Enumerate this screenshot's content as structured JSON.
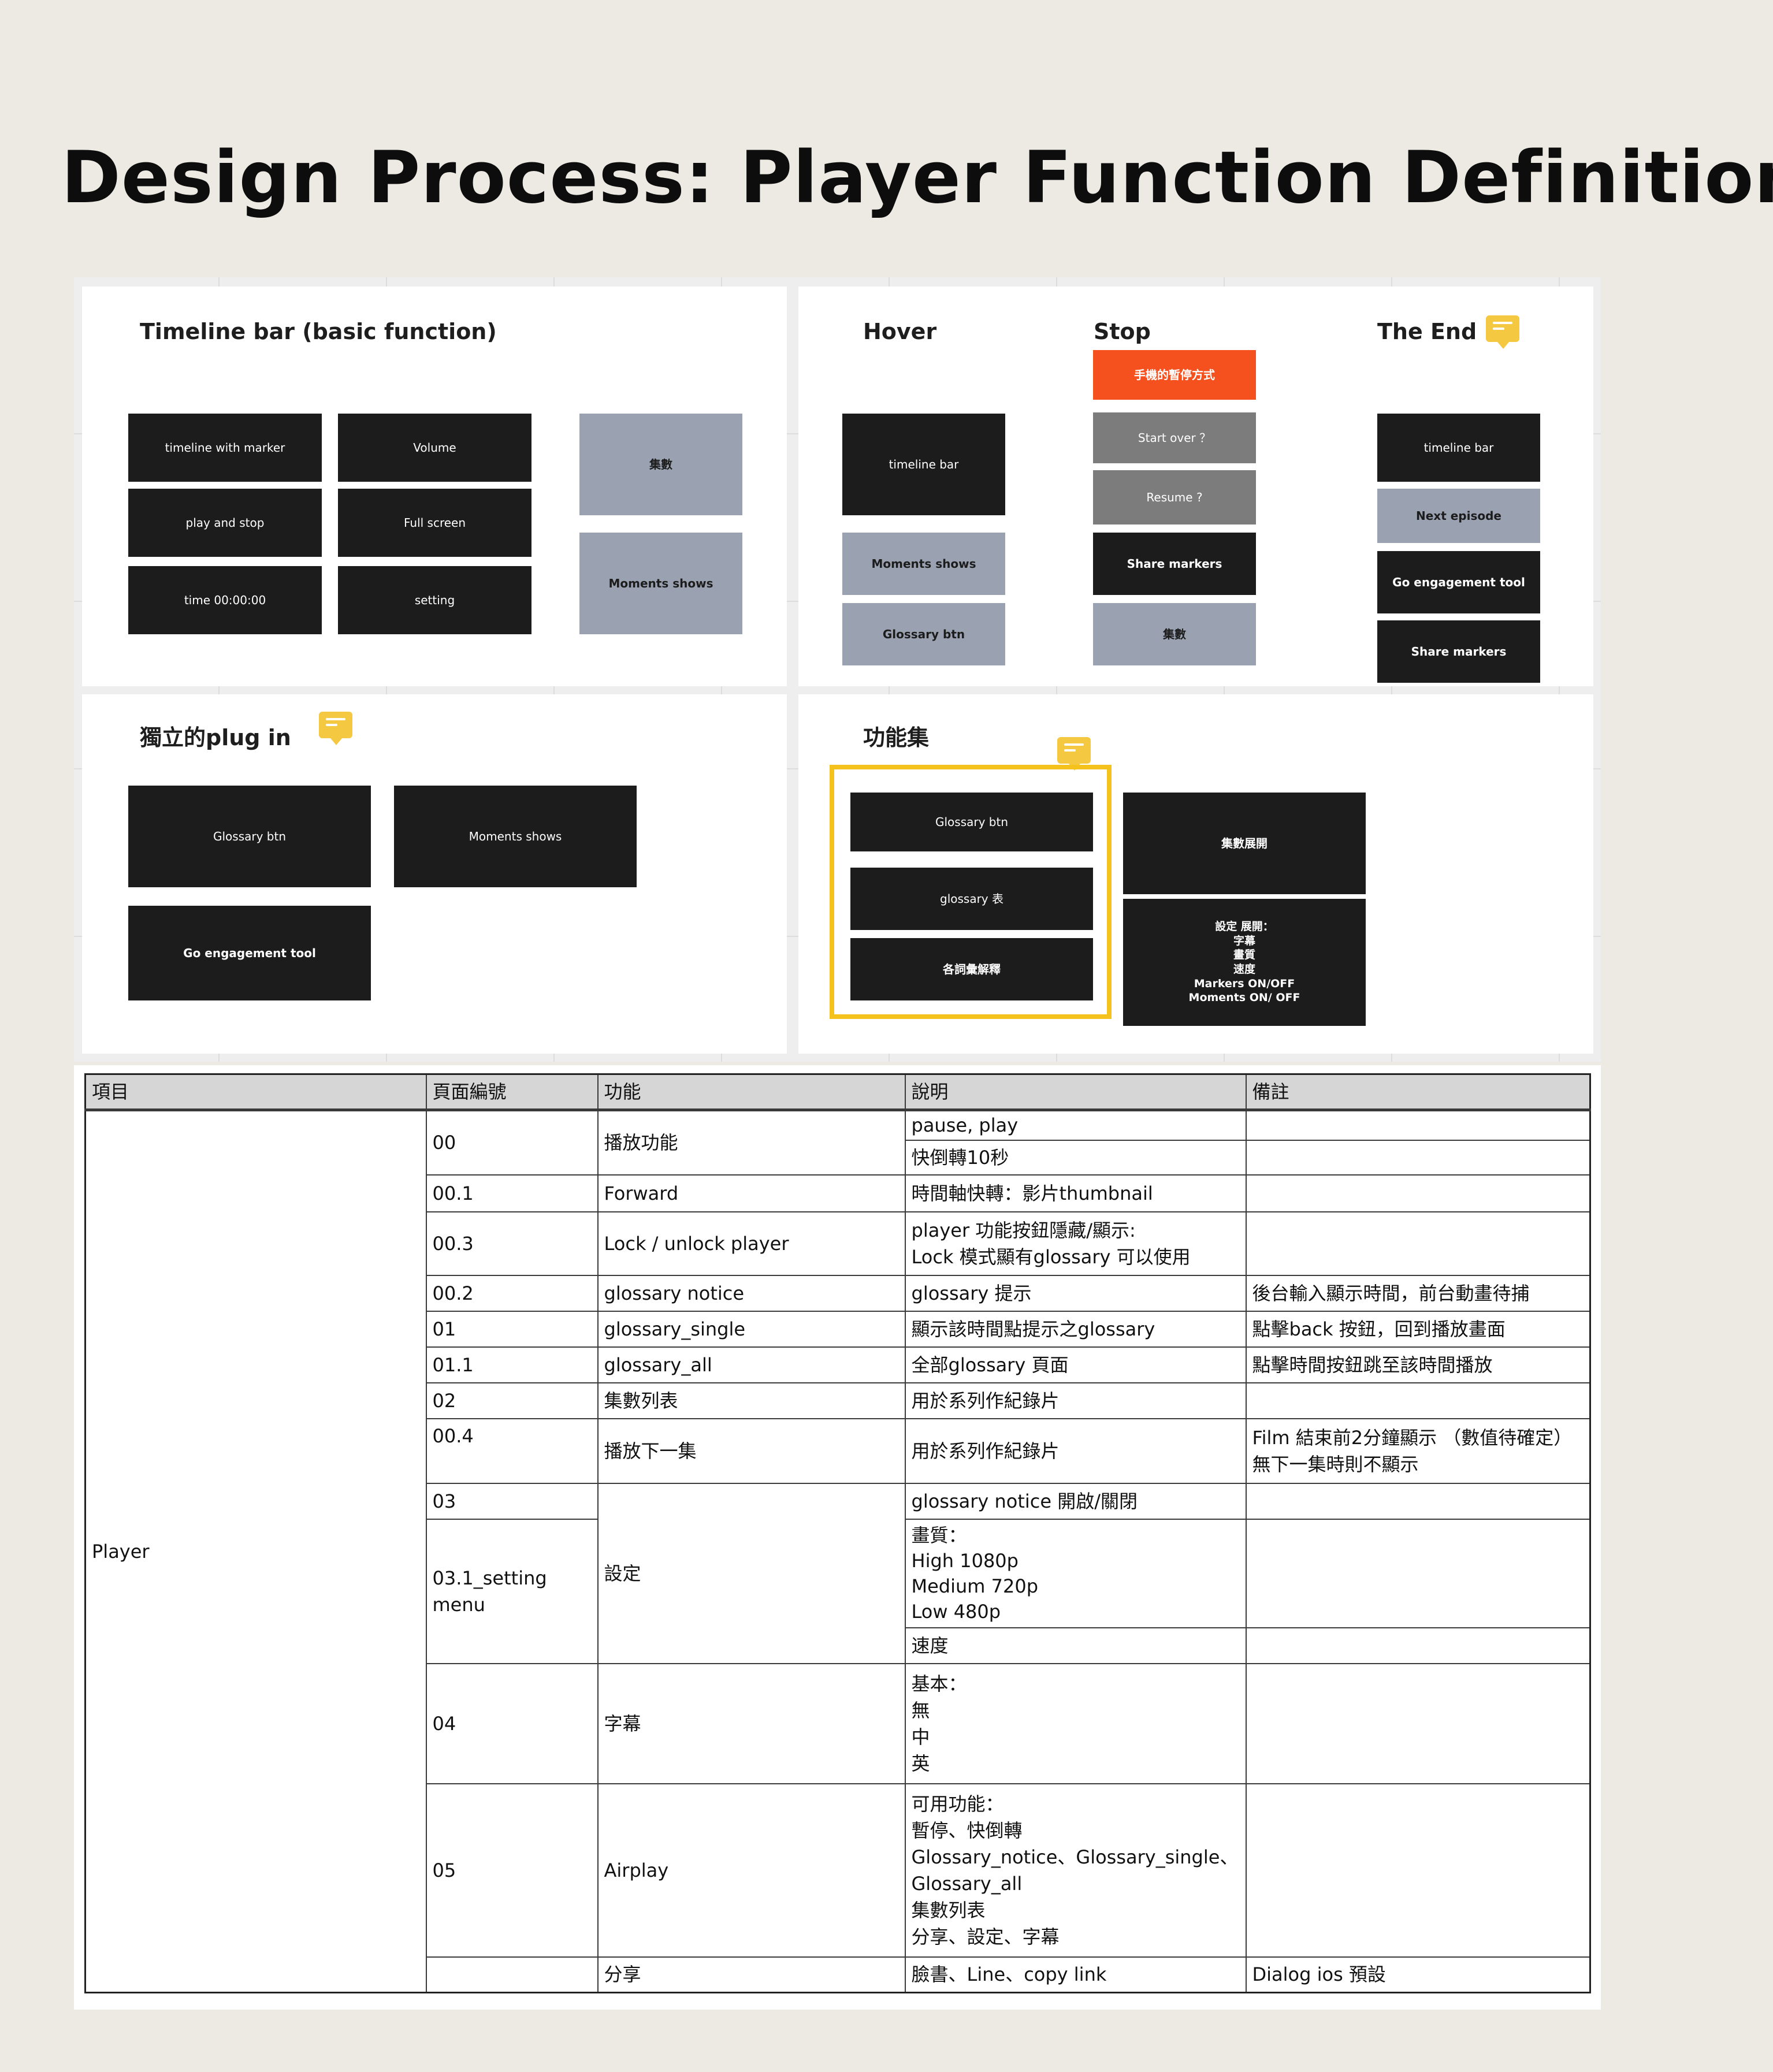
{
  "title": "Design Process: Player Function Definition",
  "board": {
    "timeline": {
      "title": "Timeline bar (basic function)",
      "cards": [
        "timeline with marker",
        "Volume",
        "play and stop",
        "Full screen",
        "time 00:00:00",
        "setting"
      ],
      "side_cards": [
        "集數",
        "Moments shows"
      ]
    },
    "hover": {
      "title": "Hover",
      "cards": [
        "timeline bar",
        "Moments shows",
        "Glossary btn"
      ]
    },
    "stop": {
      "title": "Stop",
      "badge": "手機的暫停方式",
      "cards": [
        "Start over ？",
        "Resume ?",
        "Share markers",
        "集數"
      ]
    },
    "end": {
      "title": "The End",
      "cards": [
        "timeline bar",
        "Next episode",
        "Go engagement tool",
        "Share markers"
      ]
    },
    "plugin": {
      "title": "獨立的plug in",
      "cards": [
        "Glossary btn",
        "Moments shows",
        "Go engagement tool"
      ]
    },
    "features": {
      "title": "功能集",
      "highlight_cards": [
        "Glossary btn",
        "glossary 表",
        "各詞彙解釋"
      ],
      "cards": [
        "集數展開",
        "設定 展開：\n字幕\n畫質\n速度\nMarkers ON/OFF\nMoments ON/ OFF"
      ]
    },
    "comment_icon_color": "#f5c842",
    "highlight_color": "#f5c11d"
  },
  "table": {
    "headers": [
      "項目",
      "頁面編號",
      "功能",
      "說明",
      "備註"
    ],
    "item": "Player",
    "rows": [
      {
        "page": "00",
        "func": "播放功能",
        "desc": [
          "pause, play",
          "快倒轉10秒"
        ],
        "note": [
          "",
          ""
        ]
      },
      {
        "page": "00.1",
        "func": "Forward",
        "desc": "時間軸快轉：影片thumbnail",
        "note": ""
      },
      {
        "page": "00.3",
        "func": "Lock / unlock player",
        "desc": "player 功能按鈕隱藏/顯示:\nLock 模式顯有glossary 可以使用",
        "note": ""
      },
      {
        "page": "00.2",
        "func": "glossary notice",
        "desc": "glossary 提示",
        "note": "後台輸入顯示時間，前台動畫待捕"
      },
      {
        "page": "01",
        "func": "glossary_single",
        "desc": "顯示該時間點提示之glossary",
        "note": "點擊back 按鈕，回到播放畫面"
      },
      {
        "page": "01.1",
        "func": "glossary_all",
        "desc": "全部glossary 頁面",
        "note": "點擊時間按鈕跳至該時間播放"
      },
      {
        "page": "02",
        "func": "集數列表",
        "desc": "用於系列作紀錄片",
        "note": ""
      },
      {
        "page": "00.4",
        "func": "播放下一集",
        "desc": "用於系列作紀錄片",
        "note": "Film 結束前2分鐘顯示 （數值待確定）\n無下一集時則不顯示"
      },
      {
        "page": "03",
        "page2": "03.1_setting menu",
        "func": "設定",
        "desc": [
          "glossary notice 開啟/關閉",
          "畫質：\nHigh 1080p\nMedium 720p\nLow 480p",
          "速度"
        ],
        "note": [
          "",
          "",
          ""
        ]
      },
      {
        "page": "04",
        "func": "字幕",
        "desc": "基本：\n無\n中\n英",
        "note": ""
      },
      {
        "page": "05",
        "func": "Airplay",
        "desc": "可用功能：\n暫停、快倒轉\nGlossary_notice、Glossary_single、\nGlossary_all\n集數列表\n分享、設定、字幕",
        "note": ""
      },
      {
        "page": "",
        "func": "分享",
        "desc": "臉書、Line、copy link",
        "note": "Dialog ios 預設"
      }
    ]
  }
}
